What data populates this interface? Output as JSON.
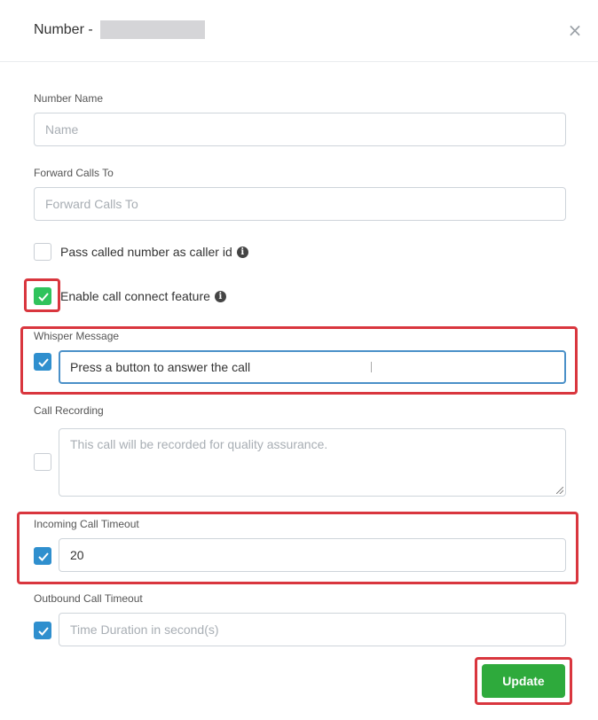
{
  "header": {
    "title": "Number -",
    "close_icon": "×"
  },
  "form": {
    "number_name": {
      "label": "Number Name",
      "placeholder": "Name",
      "value": ""
    },
    "forward_calls": {
      "label": "Forward Calls To",
      "placeholder": "Forward Calls To",
      "value": ""
    },
    "pass_caller_id": {
      "label": "Pass called number as caller id",
      "checked": false,
      "info_icon": "i"
    },
    "call_connect": {
      "label": "Enable call connect feature",
      "checked": true,
      "info_icon": "i"
    },
    "whisper": {
      "label": "Whisper Message",
      "checked": true,
      "value": "Press a button to answer the call"
    },
    "recording": {
      "label": "Call Recording",
      "checked": false,
      "placeholder": "This call will be recorded for quality assurance."
    },
    "incoming_timeout": {
      "label": "Incoming Call Timeout",
      "checked": true,
      "value": "20"
    },
    "outbound_timeout": {
      "label": "Outbound Call Timeout",
      "checked": true,
      "placeholder": "Time Duration in second(s)"
    }
  },
  "footer": {
    "update_label": "Update"
  },
  "colors": {
    "checkbox_blue": "#2f8fce",
    "checkbox_green": "#2fc35c",
    "update_button": "#2eaa3c",
    "highlight_red": "#d9363e"
  }
}
